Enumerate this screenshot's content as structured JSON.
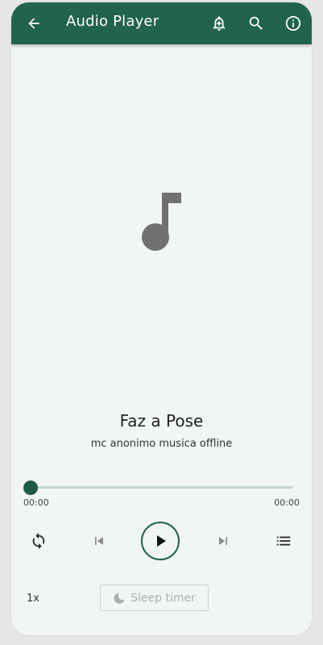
{
  "header": {
    "title": "Audio Player",
    "icons": [
      "back-arrow-icon",
      "add-alarm-bell-icon",
      "search-icon",
      "info-icon"
    ]
  },
  "track": {
    "title": "Faz a Pose",
    "artist": "mc anonimo musica offline",
    "art_icon": "music-note-icon"
  },
  "progress": {
    "current_time": "00:00",
    "total_time": "00:00",
    "fraction": 0
  },
  "controls": {
    "icons": [
      "repeat-icon",
      "previous-icon",
      "play-icon",
      "next-icon",
      "playlist-icon"
    ]
  },
  "footer": {
    "speed": "1x",
    "sleep_timer": "Sleep timer",
    "sleep_icon": "moon-icon"
  },
  "colors": {
    "accent": "#22634c",
    "background": "#f1f6f3"
  }
}
